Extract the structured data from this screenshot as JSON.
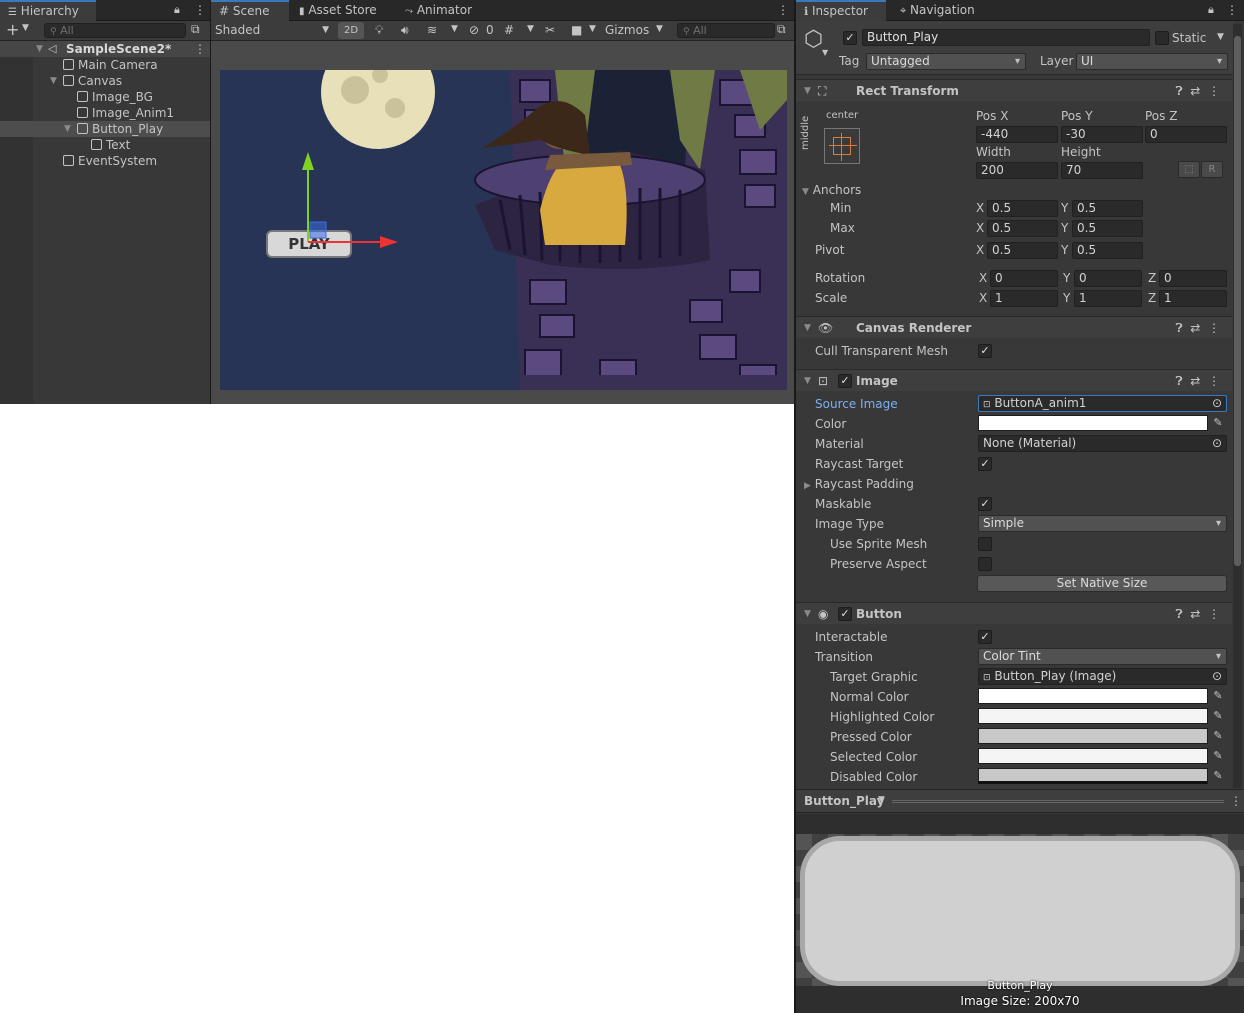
{
  "hierarchy": {
    "tab": "Hierarchy",
    "search_placeholder": "All",
    "scene": "SampleScene2*",
    "items": [
      "Main Camera",
      "Canvas",
      "Image_BG",
      "Image_Anim1",
      "Button_Play",
      "Text",
      "EventSystem"
    ]
  },
  "scene": {
    "tabs": [
      "Scene",
      "Asset Store",
      "Animator"
    ],
    "shading": "Shaded",
    "mode_2d": "2D",
    "hidden_count": "0",
    "gizmos": "Gizmos",
    "search_placeholder": "All",
    "button_text": "PLAY"
  },
  "inspector": {
    "tabs": [
      "Inspector",
      "Navigation"
    ],
    "object_name": "Button_Play",
    "static_label": "Static",
    "tag_label": "Tag",
    "tag_value": "Untagged",
    "layer_label": "Layer",
    "layer_value": "UI",
    "rect_transform": {
      "title": "Rect Transform",
      "anchor_h": "center",
      "anchor_v": "middle",
      "pos_x_label": "Pos X",
      "pos_x": "-440",
      "pos_y_label": "Pos Y",
      "pos_y": "-30",
      "pos_z_label": "Pos Z",
      "pos_z": "0",
      "width_label": "Width",
      "width": "200",
      "height_label": "Height",
      "height": "70",
      "r_button": "R",
      "anchors_label": "Anchors",
      "min_label": "Min",
      "min_x": "0.5",
      "min_y": "0.5",
      "max_label": "Max",
      "max_x": "0.5",
      "max_y": "0.5",
      "pivot_label": "Pivot",
      "pivot_x": "0.5",
      "pivot_y": "0.5",
      "rotation_label": "Rotation",
      "rot_x": "0",
      "rot_y": "0",
      "rot_z": "0",
      "scale_label": "Scale",
      "scale_x": "1",
      "scale_y": "1",
      "scale_z": "1",
      "x": "X",
      "y": "Y",
      "z": "Z"
    },
    "canvas_renderer": {
      "title": "Canvas Renderer",
      "cull_label": "Cull Transparent Mesh"
    },
    "image": {
      "title": "Image",
      "source_label": "Source Image",
      "source_value": "ButtonA_anim1",
      "color_label": "Color",
      "material_label": "Material",
      "material_value": "None (Material)",
      "raycast_target_label": "Raycast Target",
      "raycast_padding_label": "Raycast Padding",
      "maskable_label": "Maskable",
      "image_type_label": "Image Type",
      "image_type_value": "Simple",
      "use_sprite_mesh_label": "Use Sprite Mesh",
      "preserve_aspect_label": "Preserve Aspect",
      "set_native_size": "Set Native Size"
    },
    "button": {
      "title": "Button",
      "interactable_label": "Interactable",
      "transition_label": "Transition",
      "transition_value": "Color Tint",
      "target_graphic_label": "Target Graphic",
      "target_graphic_value": "Button_Play (Image)",
      "normal_label": "Normal Color",
      "highlighted_label": "Highlighted Color",
      "pressed_label": "Pressed Color",
      "selected_label": "Selected Color",
      "disabled_label": "Disabled Color"
    },
    "preview": {
      "title": "Button_Play",
      "name": "Button_Play",
      "size": "Image Size: 200x70"
    }
  },
  "colors": {
    "accent": "#3a79bb",
    "link": "#7bb0f0",
    "normal_color": "#ffffff",
    "highlighted_color": "#f5f5f5",
    "pressed_color": "#c8c8c8",
    "selected_color": "#f5f5f5",
    "disabled_color": "#c8c8c8"
  }
}
